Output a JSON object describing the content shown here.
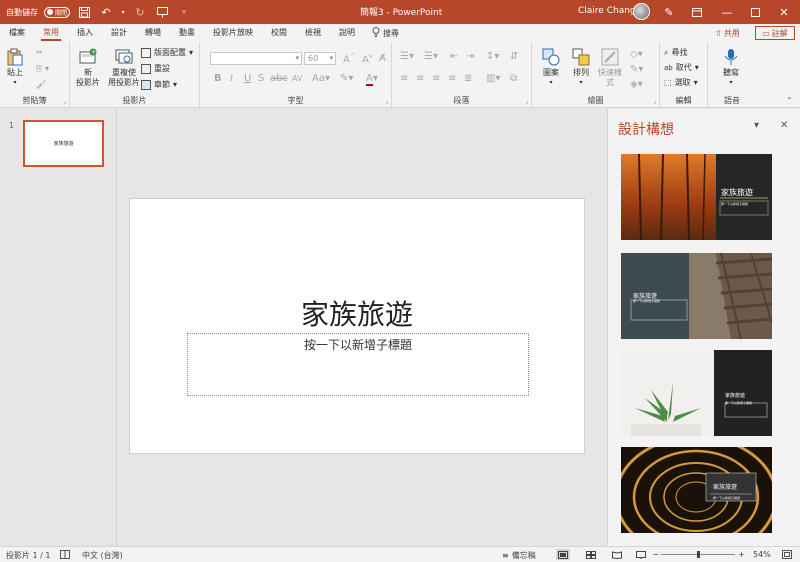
{
  "titlebar": {
    "autosave_label": "自動儲存",
    "autosave_state": "關閉",
    "doc_title": "簡報3 - PowerPoint",
    "user_name": "Claire Chang",
    "accent": "#b7472a"
  },
  "tabs": [
    "檔案",
    "常用",
    "插入",
    "設計",
    "轉場",
    "動畫",
    "投影片放映",
    "校閱",
    "檢視",
    "說明"
  ],
  "active_tab": "常用",
  "search_label": "搜尋",
  "share_label": "共用",
  "comment_label": "註解",
  "ribbon": {
    "clipboard": {
      "label": "剪貼簿",
      "paste": "貼上"
    },
    "slides": {
      "label": "投影片",
      "new_slide_1": "新",
      "new_slide_2": "投影片",
      "reuse_1": "重複使",
      "reuse_2": "用投影片",
      "layout": "版面配置",
      "reset": "重設",
      "section": "章節"
    },
    "font": {
      "label": "字型",
      "font_size": "60",
      "bold": "B",
      "italic": "I",
      "underline": "U",
      "strike": "S",
      "aa": "AV",
      "font_color": "A"
    },
    "paragraph": {
      "label": "段落"
    },
    "drawing": {
      "label": "繪圖",
      "shapes": "圖案",
      "arrange": "排列",
      "quick_styles_1": "快速樣",
      "quick_styles_2": "式"
    },
    "editing": {
      "label": "編輯",
      "find": "尋找",
      "replace": "取代",
      "select": "選取"
    },
    "voice": {
      "label": "語音",
      "dictate": "聽寫"
    }
  },
  "thumbnails": [
    {
      "num": "1",
      "title": "家族旅遊"
    }
  ],
  "slide": {
    "title": "家族旅遊",
    "subtitle": "按一下以新增子標題"
  },
  "designer": {
    "title": "設計構想",
    "designs": [
      {
        "title": "家族旅遊",
        "sub": "按一下以新增子標題",
        "image": "autumn-forest"
      },
      {
        "title": "家族旅遊",
        "sub": "按一下以新增子標題",
        "image": "railway-track"
      },
      {
        "title": "家族旅遊",
        "sub": "按一下以新增子標題",
        "image": "succulent-plant"
      },
      {
        "title": "家族旅遊",
        "sub": "按一下以新增子標題",
        "image": "light-tunnel"
      }
    ]
  },
  "statusbar": {
    "slide_count": "投影片 1 / 1",
    "language": "中文 (台灣)",
    "notes": "備忘稿",
    "zoom": "54%",
    "zoom_fraction": 0.5
  }
}
